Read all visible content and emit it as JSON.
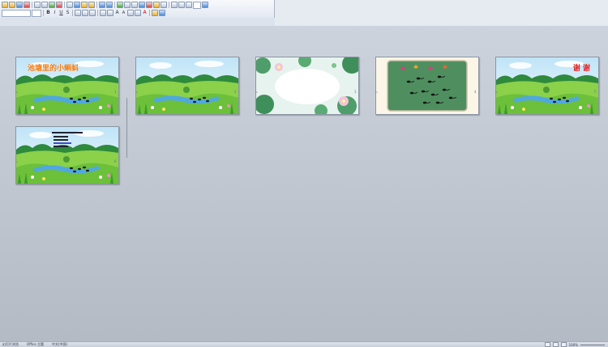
{
  "toolbar": {
    "row1_icons": [
      "new-icon",
      "open-icon",
      "save-icon",
      "print-icon",
      "preview-icon",
      "spell-icon",
      "cut-icon",
      "copy-icon",
      "paste-icon",
      "format-painter-icon",
      "undo-icon",
      "redo-icon",
      "chart-icon",
      "table-icon",
      "columns-icon",
      "grid-icon",
      "insert-picture-icon",
      "wordart-icon",
      "color-icon",
      "zoom-icon",
      "help-icon"
    ],
    "row2_icons": [
      "bold-icon",
      "italic-icon",
      "underline-icon",
      "shadow-icon",
      "align-left-icon",
      "center-icon",
      "align-right-icon",
      "numbering-icon",
      "bullets-icon",
      "grow-font-icon",
      "shrink-font-icon",
      "decrease-indent-icon",
      "increase-indent-icon",
      "font-color-icon",
      "design-icon",
      "new-slide-icon"
    ],
    "font_name": "",
    "font_size": ""
  },
  "slides": [
    {
      "number": "1",
      "title_text": "池塘里的小蝌蚪",
      "theme": "meadow-title"
    },
    {
      "number": "2",
      "theme": "meadow"
    },
    {
      "number": "3",
      "theme": "lotus-pond"
    },
    {
      "number": "4",
      "theme": "tadpoles-board"
    },
    {
      "number": "5",
      "title_text": "谢 谢",
      "theme": "meadow-thanks"
    },
    {
      "number": "6",
      "theme": "meadow-text"
    }
  ],
  "status": {
    "view": "幻灯片浏览",
    "design": "Office 主题",
    "language": "中文(中国)",
    "zoom": "100%"
  }
}
